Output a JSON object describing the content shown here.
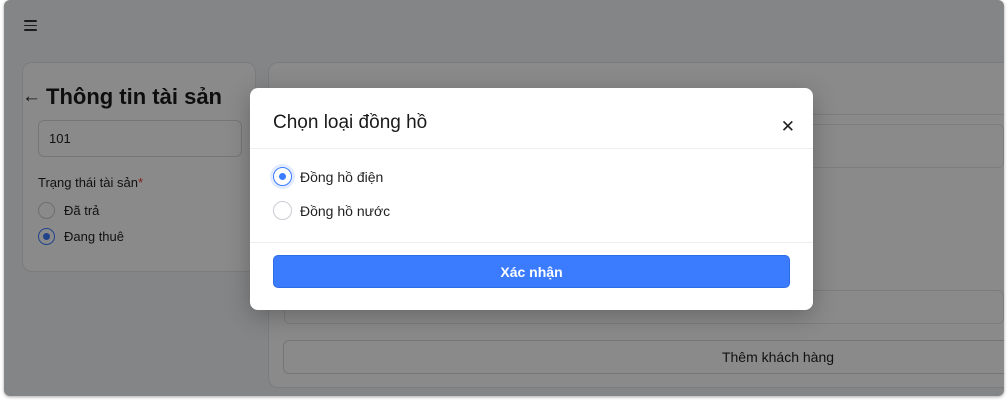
{
  "header": {
    "menu_icon": "hamburger-menu-icon"
  },
  "asset_form": {
    "title": "Thông tin tài sản",
    "back_icon": "arrow-left-icon",
    "room_value": "101",
    "status_label": "Trạng thái tài sản",
    "required_mark": "*",
    "status_options": [
      {
        "label": "Đã trả",
        "selected": false
      },
      {
        "label": "Đang thuê",
        "selected": true
      }
    ]
  },
  "right_panel": {
    "add_customer_label": "Thêm khách hàng"
  },
  "modal": {
    "title": "Chọn loại đồng hồ",
    "close_icon": "close-icon",
    "options": [
      {
        "label": "Đồng hồ điện",
        "selected": true
      },
      {
        "label": "Đồng hồ nước",
        "selected": false
      }
    ],
    "confirm_label": "Xác nhận"
  },
  "colors": {
    "accent": "#3b7cff",
    "required": "#e53935",
    "overlay": "rgba(0,0,0,0.46)"
  }
}
